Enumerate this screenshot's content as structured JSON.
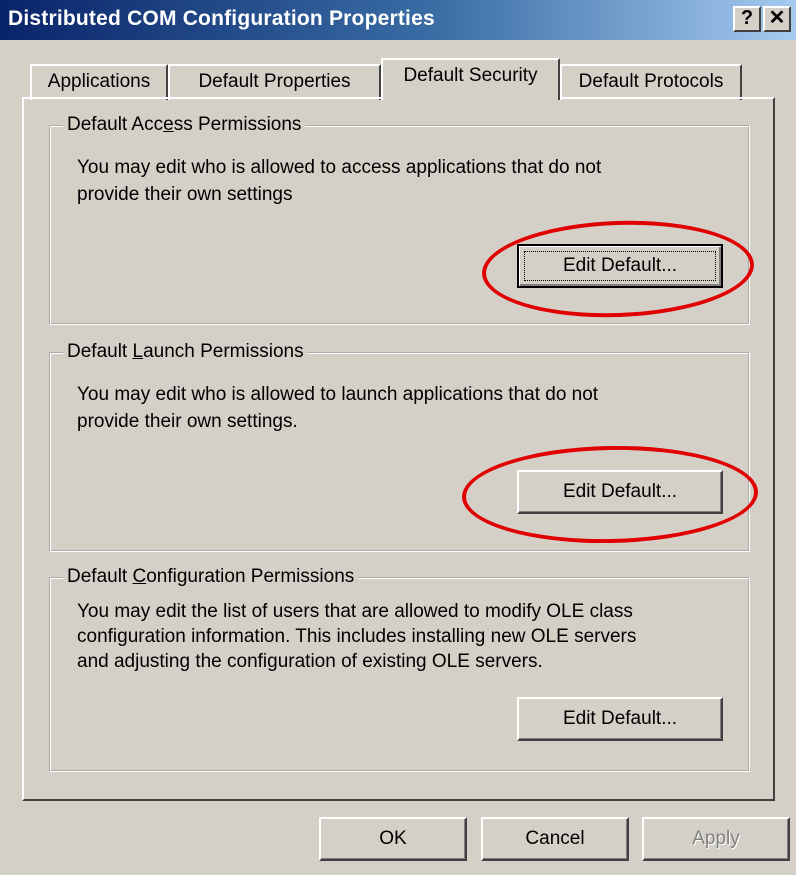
{
  "window": {
    "title": "Distributed COM Configuration Properties",
    "help_button": "?",
    "close_button": "✕"
  },
  "tabs": [
    {
      "label": "Applications",
      "active": false
    },
    {
      "label": "Default Properties",
      "active": false
    },
    {
      "label": "Default Security",
      "active": true
    },
    {
      "label": "Default Protocols",
      "active": false
    }
  ],
  "groups": {
    "access": {
      "title_pre": "Default Acc",
      "title_mnemonic": "e",
      "title_post": "ss Permissions",
      "description_line1": "You may edit who is allowed to access applications that do not",
      "description_line2": "provide their own settings",
      "button_label": "Edit Default..."
    },
    "launch": {
      "title_pre": "Default ",
      "title_mnemonic": "L",
      "title_post": "aunch Permissions",
      "description_line1": "You may edit who is allowed to launch applications that do not",
      "description_line2": "provide their own settings.",
      "button_label": "Edit Default..."
    },
    "configuration": {
      "title_pre": "Default ",
      "title_mnemonic": "C",
      "title_post": "onfiguration Permissions",
      "description_line1": "You may edit the list of users that are allowed to modify OLE class",
      "description_line2": "configuration information.  This includes installing new OLE servers",
      "description_line3": "and adjusting the configuration of existing OLE servers.",
      "button_label": "Edit Default..."
    }
  },
  "footer": {
    "ok_label": "OK",
    "cancel_label": "Cancel",
    "apply_label": "Apply"
  },
  "annotations": {
    "color": "#e00000"
  },
  "colors": {
    "dialog_face": "#d4d0c8",
    "title_gradient_start": "#0a246a",
    "title_gradient_end": "#a6caf0"
  }
}
